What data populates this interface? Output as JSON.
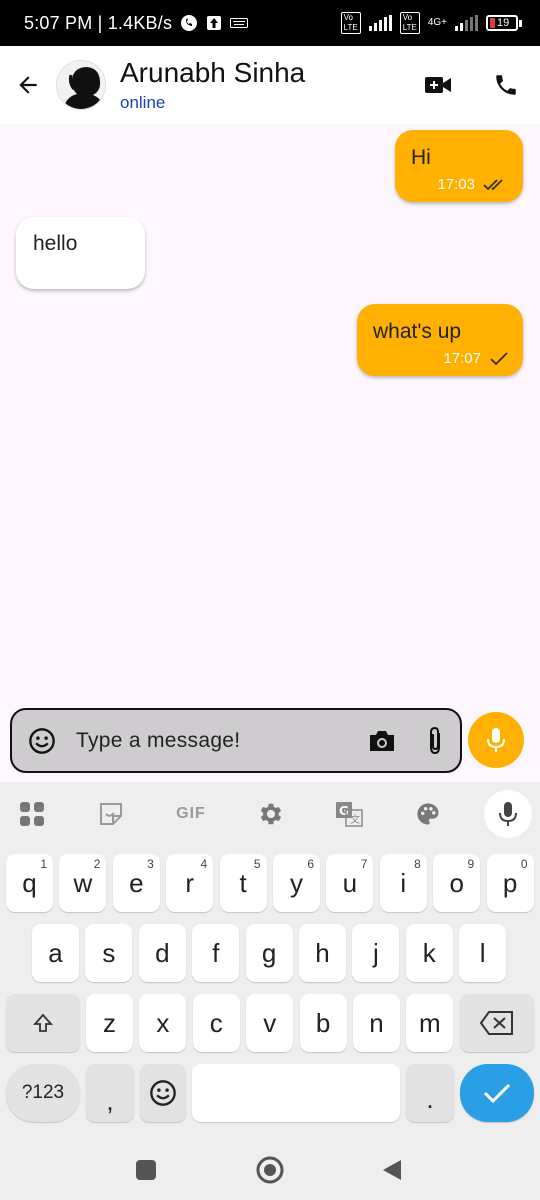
{
  "status_bar": {
    "time": "5:07 PM | 1.4KB/s",
    "network_label": "4G+",
    "battery_level": "19"
  },
  "header": {
    "contact_name": "Arunabh Sinha",
    "contact_status": "online",
    "back_icon": "arrow-back-icon",
    "video_icon": "video-call-icon",
    "call_icon": "phone-icon"
  },
  "messages": [
    {
      "direction": "out",
      "text": "Hi",
      "time": "17:03",
      "status": "read"
    },
    {
      "direction": "in",
      "text": "hello"
    },
    {
      "direction": "out",
      "text": "what's up",
      "time": "17:07",
      "status": "sent"
    }
  ],
  "composer": {
    "placeholder": "Type a message!",
    "emoji_icon": "emoji-icon",
    "camera_icon": "camera-icon",
    "attach_icon": "attach-icon",
    "mic_icon": "mic-icon"
  },
  "keyboard": {
    "toolbar": [
      "apps-icon",
      "sticker-icon",
      "GIF",
      "settings-icon",
      "translate-icon",
      "palette-icon",
      "voice-icon"
    ],
    "row1": [
      {
        "label": "q",
        "hint": "1"
      },
      {
        "label": "w",
        "hint": "2"
      },
      {
        "label": "e",
        "hint": "3"
      },
      {
        "label": "r",
        "hint": "4"
      },
      {
        "label": "t",
        "hint": "5"
      },
      {
        "label": "y",
        "hint": "6"
      },
      {
        "label": "u",
        "hint": "7"
      },
      {
        "label": "i",
        "hint": "8"
      },
      {
        "label": "o",
        "hint": "9"
      },
      {
        "label": "p",
        "hint": "0"
      }
    ],
    "row2": [
      "a",
      "s",
      "d",
      "f",
      "g",
      "h",
      "j",
      "k",
      "l"
    ],
    "row3": [
      "z",
      "x",
      "c",
      "v",
      "b",
      "n",
      "m"
    ],
    "symbols_label": "?123",
    "comma": ",",
    "period": "."
  },
  "colors": {
    "accent": "#ffb000",
    "link": "#1a3fbf",
    "enter": "#2a9fe6",
    "background": "#fdf6fd"
  }
}
